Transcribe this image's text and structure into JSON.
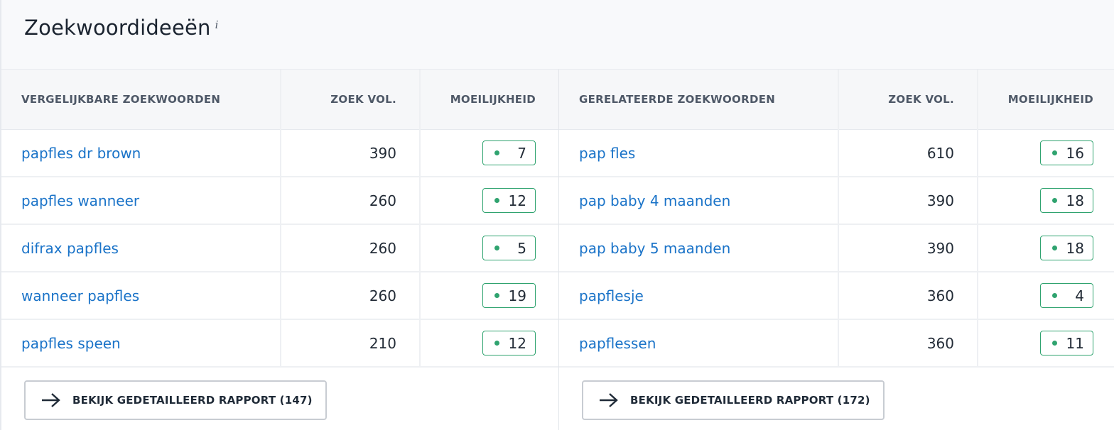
{
  "header": {
    "title": "Zoekwoordideeën",
    "info_icon": "i"
  },
  "colors": {
    "link": "#1a73c8",
    "badge_green": "#2fa36f"
  },
  "similar": {
    "columns": [
      "VERGELIJKBARE ZOEKWOORDEN",
      "ZOEK VOL.",
      "MOEILIJKHEID"
    ],
    "rows": [
      {
        "keyword": "papfles dr brown",
        "volume": "390",
        "difficulty": "7"
      },
      {
        "keyword": "papfles wanneer",
        "volume": "260",
        "difficulty": "12"
      },
      {
        "keyword": "difrax papfles",
        "volume": "260",
        "difficulty": "5"
      },
      {
        "keyword": "wanneer papfles",
        "volume": "260",
        "difficulty": "19"
      },
      {
        "keyword": "papfles speen",
        "volume": "210",
        "difficulty": "12"
      }
    ],
    "report_label": "BEKIJK GEDETAILLEERD RAPPORT (147)"
  },
  "related": {
    "columns": [
      "GERELATEERDE ZOEKWOORDEN",
      "ZOEK VOL.",
      "MOEILIJKHEID"
    ],
    "rows": [
      {
        "keyword": "pap fles",
        "volume": "610",
        "difficulty": "16"
      },
      {
        "keyword": "pap baby 4 maanden",
        "volume": "390",
        "difficulty": "18"
      },
      {
        "keyword": "pap baby 5 maanden",
        "volume": "390",
        "difficulty": "18"
      },
      {
        "keyword": "papflesje",
        "volume": "360",
        "difficulty": "4"
      },
      {
        "keyword": "papflessen",
        "volume": "360",
        "difficulty": "11"
      }
    ],
    "report_label": "BEKIJK GEDETAILLEERD RAPPORT (172)"
  }
}
